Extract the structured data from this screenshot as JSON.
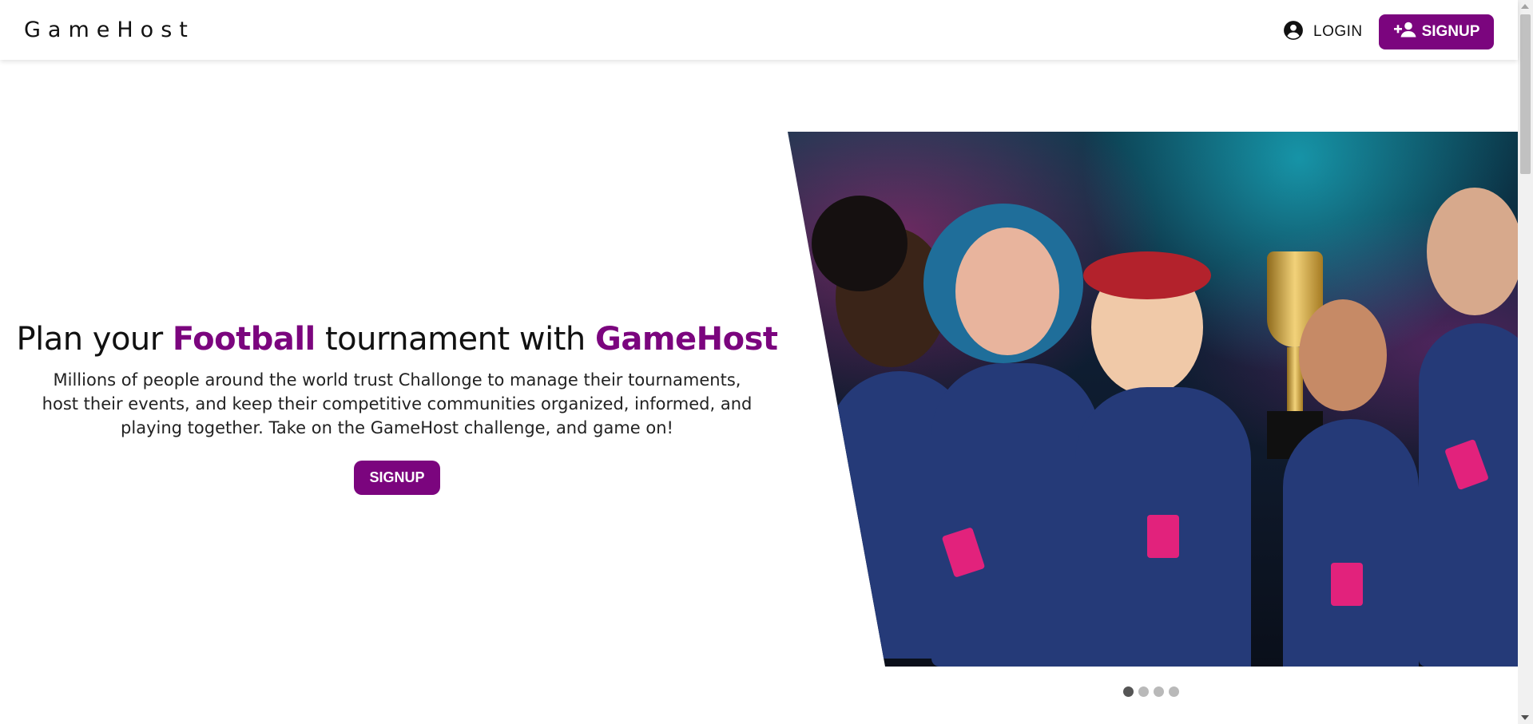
{
  "navbar": {
    "brand": "GameHost",
    "login_label": "LOGIN",
    "signup_label": "SIGNUP",
    "login_icon": "account-circle-icon",
    "signup_icon": "person-add-icon"
  },
  "hero": {
    "title_part1": "Plan your ",
    "title_accent1": "Football",
    "title_part2": " tournament with ",
    "title_accent2": "GameHost",
    "description": "Millions of people around the world trust Challonge to manage their tournaments, host their events, and keep their competitive communities organized, informed, and playing together. Take on the GameHost challenge, and game on!",
    "signup_label": "SIGNUP",
    "image_alt": "Esports team celebrating with a trophy"
  },
  "carousel": {
    "slide_count": 4,
    "active_index": 0
  },
  "colors": {
    "accent": "#7b057e",
    "background": "#ffffff",
    "text": "#111111"
  }
}
